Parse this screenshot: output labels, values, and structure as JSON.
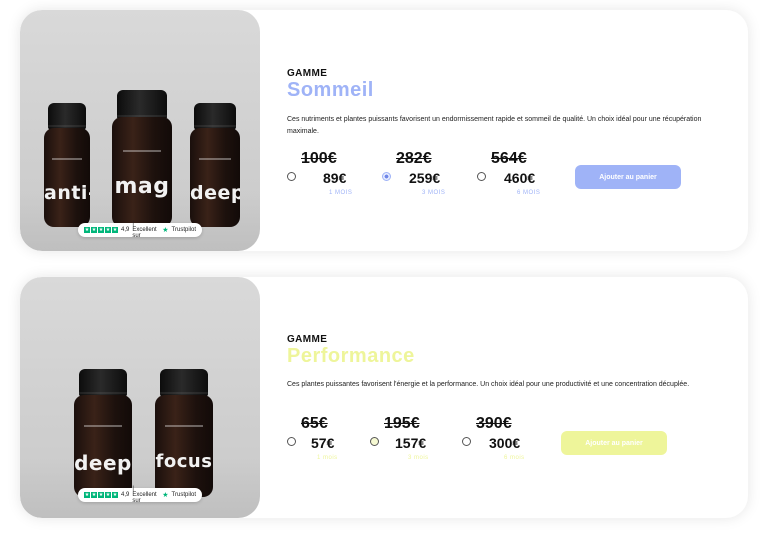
{
  "colors": {
    "sommeil_accent": "#9fb3f7",
    "performance_accent": "#eef59a",
    "trustpilot_green": "#00b67a"
  },
  "cards": [
    {
      "eyebrow": "GAMME",
      "title": "Sommeil",
      "accent": "#9fb3f7",
      "description": "Ces nutriments et plantes puissants favorisent un endormissement rapide et sommeil de qualité. Un choix idéal pour une récupération maximale.",
      "jars": [
        "anti-",
        "mag",
        "deep"
      ],
      "badge": {
        "rating": "4,9",
        "text": "| Excellent sur",
        "brand": "Trustpilot"
      },
      "options": [
        {
          "old_price": "100€",
          "new_price": "89€",
          "duration": "1 MOIS",
          "selected": false
        },
        {
          "old_price": "282€",
          "new_price": "259€",
          "duration": "3 MOIS",
          "selected": true
        },
        {
          "old_price": "564€",
          "new_price": "460€",
          "duration": "6 MOIS",
          "selected": false
        }
      ],
      "cta": "Ajouter au panier"
    },
    {
      "eyebrow": "GAMME",
      "title": "Performance",
      "accent": "#eef59a",
      "description": "Ces plantes puissantes favorisent l'énergie et la performance. Un choix idéal pour une productivité et une concentration décuplée.",
      "jars": [
        "deep",
        "focus"
      ],
      "badge": {
        "rating": "4,9",
        "text": "| Excellent sur",
        "brand": "Trustpilot"
      },
      "options": [
        {
          "old_price": "65€",
          "new_price": "57€",
          "duration": "1 mois",
          "selected": false
        },
        {
          "old_price": "195€",
          "new_price": "157€",
          "duration": "3 mois",
          "selected": false
        },
        {
          "old_price": "390€",
          "new_price": "300€",
          "duration": "6 mois",
          "selected": false
        }
      ],
      "cta": "Ajouter au panier"
    }
  ]
}
